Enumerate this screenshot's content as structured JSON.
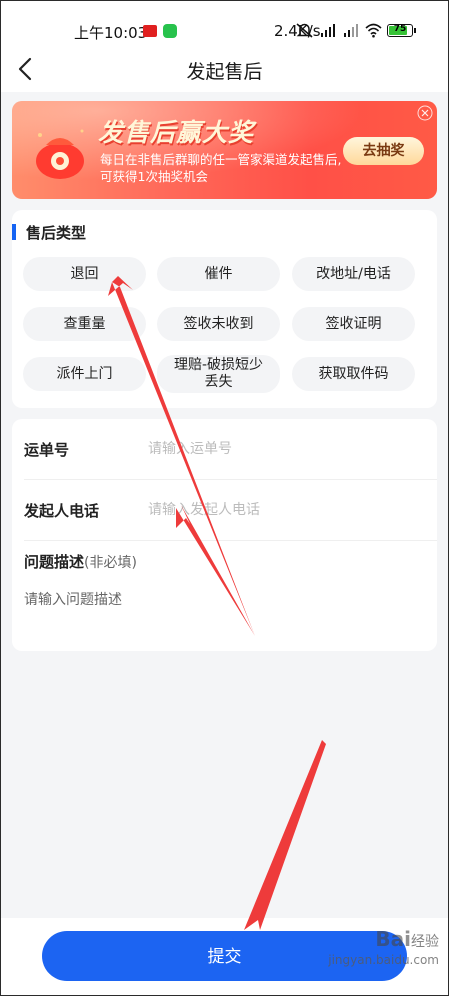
{
  "status_bar": {
    "time": "上午10:03",
    "net_speed": "2.4K/s",
    "battery": "75",
    "icons": [
      "mute-icon",
      "hd-signal-icon",
      "hd-signal-icon",
      "wifi-icon"
    ]
  },
  "nav": {
    "title": "发起售后",
    "back_icon": "chevron-left-icon"
  },
  "banner": {
    "title": "发售后赢大奖",
    "text": "每日在非售后群聊的任一管家渠道发起售后,可获得1次抽奖机会",
    "button": "去抽奖"
  },
  "type_section": {
    "title": "售后类型",
    "chips": [
      "退回",
      "催件",
      "改地址/电话",
      "查重量",
      "签收未收到",
      "签收证明",
      "派件上门",
      "理赔-破损短少丢失",
      "获取取件码"
    ]
  },
  "form": {
    "waybill_label": "运单号",
    "waybill_placeholder": "请输入运单号",
    "phone_label": "发起人电话",
    "phone_placeholder": "请输入发起人电话",
    "desc_label": "问题描述",
    "desc_optional": "(非必填)",
    "desc_placeholder": "请输入问题描述"
  },
  "submit": {
    "label": "提交"
  },
  "watermark": {
    "brand": "Bai",
    "brand_cn": "经验",
    "url": "jingyan.baidu.com"
  },
  "colors": {
    "accent": "#1c64f2",
    "annotation": "#ee3b3b"
  }
}
